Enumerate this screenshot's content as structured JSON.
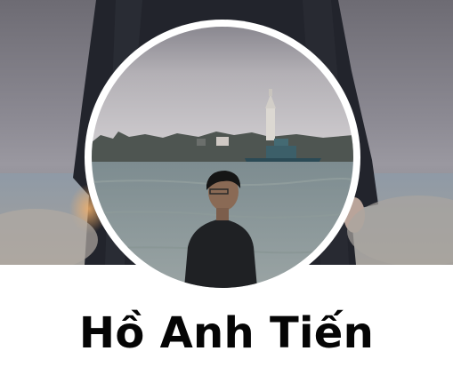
{
  "profile": {
    "name": "Hồ Anh Tiến"
  },
  "colors": {
    "name_text": "#050505",
    "page_background": "#ffffff",
    "avatar_border": "#ffffff"
  }
}
